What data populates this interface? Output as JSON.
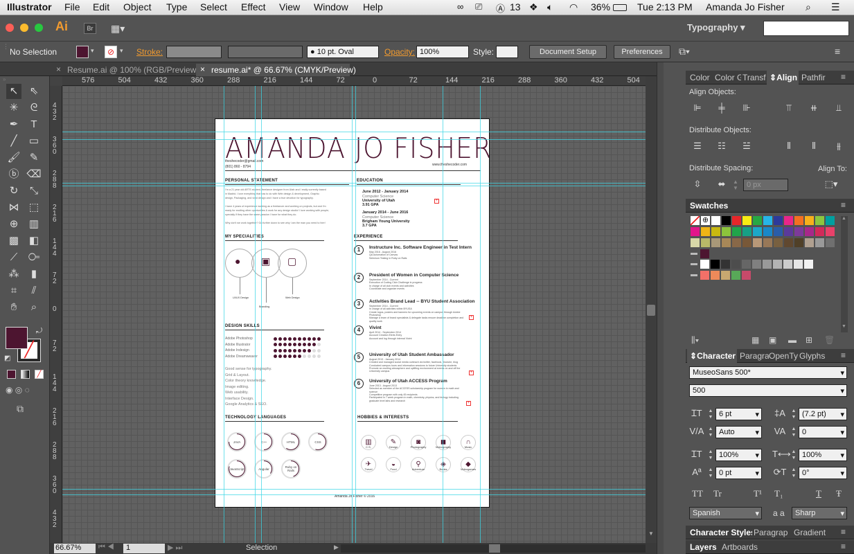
{
  "menubar": {
    "app": "Illustrator",
    "items": [
      "File",
      "Edit",
      "Object",
      "Type",
      "Select",
      "Effect",
      "View",
      "Window",
      "Help"
    ],
    "status": {
      "adobe_count": "13",
      "battery": "36%",
      "clock": "Tue 2:13 PM",
      "user": "Amanda Jo Fisher"
    }
  },
  "appbar": {
    "logo": "Ai",
    "bridge": "Br",
    "workspace": "Typography",
    "search_value": ""
  },
  "control": {
    "selection": "No Selection",
    "stroke_label": "Stroke:",
    "brush": "10 pt. Oval",
    "opacity_label": "Opacity:",
    "opacity_value": "100%",
    "style_label": "Style:",
    "document_setup": "Document Setup",
    "preferences": "Preferences"
  },
  "tabs": [
    {
      "label": "Resume.ai @ 100% (RGB/Preview)",
      "active": false
    },
    {
      "label": "resume.ai* @ 66.67% (CMYK/Preview)",
      "active": true
    }
  ],
  "ruler": {
    "h": [
      "576",
      "504",
      "432",
      "360",
      "288",
      "216",
      "144",
      "72",
      "0",
      "72",
      "144",
      "216",
      "288",
      "360",
      "432",
      "504",
      "576"
    ],
    "v": [
      "4 3 2",
      "3 6 0",
      "2 8 8",
      "2 1 6",
      "1 4 4",
      "7 2",
      "0",
      "7 2",
      "1 4 4",
      "2 1 6",
      "2 8 8",
      "3 6 0",
      "4 3 2"
    ]
  },
  "status": {
    "zoom": "66.67%",
    "page": "1",
    "tool": "Selection"
  },
  "resume": {
    "name": "AMANDA JO FISHER",
    "email": "theshecoder@gmail.com",
    "phone": "(801) 860 - 8794",
    "website": "www.theshecoder.com",
    "personal_statement_h": "PERSONAL STATEMENT",
    "personal_statement": [
      "I'm a 21 year old ARTS student, freelance designer from Utah and I really currently based",
      "in Madrid. I love everything that has to do with Web design & development, Graphic",
      "design, Packaging, and vivid design and I have a true devotion for typography.",
      "I have 4 years of experience working as a freelancer and working on projects, but and I'm",
      "ready for exciting other oportunities & work for any design studio! I love working with people,",
      "specially if they have the same passion I have for what they do.",
      "Why don't we work together? Go further down to see why I am the man you need to hire!"
    ],
    "education_h": "EDUCATION",
    "education": [
      {
        "dates": "June 2012 - January 2014",
        "field": "Computer Science",
        "school": "University of Utah",
        "gpa": "3.91 GPA"
      },
      {
        "dates": "January 2014 - June 2016",
        "field": "Computer Science",
        "school": "Brigham Young University",
        "gpa": "3.7 GPA"
      }
    ],
    "specialties_h": "MY SPECIALITIES",
    "specialties": [
      "UI/UX Design",
      "Branding",
      "Web Design"
    ],
    "experience_h": "EXPERIENCE",
    "experience": [
      {
        "n": "1",
        "title": "Instructure Inc. Software Engineer in Test Intern",
        "lines": [
          "May 2016 - August 2016",
          "QA Automation of Canvas",
          "Selenium Testing in Ruby on Rails"
        ]
      },
      {
        "n": "2",
        "title": "President of Women in Computer Science",
        "lines": [
          "September 2014 - Current",
          "Execution of Coding Club Challenge in progress",
          "In charge of all club events and activities",
          "Coordinate and organize events"
        ]
      },
      {
        "n": "3",
        "title": "Activities Brand Lead -- BYU Student Association",
        "lines": [
          "September 2014 - Current",
          "In charge of all activities within BYUSA",
          "Create logos, posters and banners for upcoming events on campus through Adobe",
          "Photoshop",
          "Manage a team of brand specialists & delegate tasks ensure deadline completion and",
          "quality work"
        ]
      },
      {
        "n": "4",
        "title": "Vivint",
        "lines": [
          "April 2014 - September 2014",
          "Account Creation Elerts Entry",
          "Account and log through internal Vivint"
        ]
      },
      {
        "n": "5",
        "title": "University of Utah Student Ambassador",
        "lines": [
          "August 2013 - January 2014",
          "Created and managed social media outreach via twitter, facebook, Youtube, blog",
          "Conducted campus tours and information sessions to future University students",
          "Promote an exciting atmosphere and uplifting environment at events on and off the",
          "University campus"
        ]
      },
      {
        "n": "6",
        "title": "University of Utah ACCESS Program",
        "lines": [
          "June 2013 - August 2013",
          "Selected as member of the ACCESS scholarship program for women in math and",
          "science",
          "Competitive program with only 45 recipients",
          "Participated in 7 week program in math, chemistry, physics, and biology including",
          "graduate level labs and research"
        ]
      }
    ],
    "design_skills_h": "DESIGN SKILLS",
    "design_skills": [
      {
        "name": "Adobe Photoshop",
        "level": 10
      },
      {
        "name": "Adobe Illustrator",
        "level": 9
      },
      {
        "name": "Adobe Indesign",
        "level": 8
      },
      {
        "name": "Adobe Dreamweaver",
        "level": 6
      }
    ],
    "skills_list": [
      "Good sense for typography.",
      "Grid & Layout.",
      "Color theory knowledge.",
      "Image editing.",
      "Web usability.",
      "Interface Design.",
      "Google Analytics & SEO."
    ],
    "tech_h": "TECHNOLOGY LANGUAGES",
    "tech": [
      {
        "name": "JAVA",
        "level": 0.75
      },
      {
        "name": "C++",
        "level": 0.5
      },
      {
        "name": "HTML",
        "level": 0.6
      },
      {
        "name": "CSS",
        "level": 0.55
      },
      {
        "name": "JavaScript",
        "level": 0.8
      },
      {
        "name": "Angular",
        "level": 0.35
      },
      {
        "name": "Ruby on Rails",
        "level": 0.45
      }
    ],
    "hobbies_h": "HOBBIES & INTERESTS",
    "hobbies": [
      "C.S.",
      "Design",
      "Photography",
      "Videography",
      "Music",
      "Travel",
      "Food",
      "Adventure",
      "Books",
      "Videogames"
    ],
    "footer": "Amanda Jo Fisher © 2016"
  },
  "panels": {
    "top_tabs": [
      "Color",
      "Color G",
      "Transf",
      "Align",
      "Pathfir"
    ],
    "active_top_tab": "Align",
    "align_objects": "Align Objects:",
    "distribute_objects": "Distribute Objects:",
    "distribute_spacing": "Distribute Spacing:",
    "align_to": "Align To:",
    "spacing_value": "0 px",
    "swatches_h": "Swatches",
    "char_tabs": [
      "Character",
      "Paragra",
      "OpenTy",
      "Glyphs"
    ],
    "font_family": "MuseoSans 500*",
    "font_style": "500",
    "size": "6 pt",
    "leading": "(7.2 pt)",
    "kerning": "Auto",
    "tracking": "0",
    "vscale": "100%",
    "hscale": "100%",
    "baseline": "0 pt",
    "rotation": "0°",
    "case_buttons": [
      "TT",
      "Tr",
      "T¹",
      "T₁",
      "T",
      "Ŧ"
    ],
    "language": "Spanish",
    "aa_label": "a a",
    "anti_alias": "Sharp",
    "bottom_tabs_1": [
      "Character Styles",
      "Paragrap",
      "Gradient"
    ],
    "bottom_tabs_2": [
      "Layers",
      "Artboards"
    ]
  },
  "colors": {
    "accent": "#4d1530",
    "guide": "#3fd7e6",
    "fill": "#4d1530"
  },
  "swatches_rows": [
    [
      "none",
      "reg",
      "#ffffff",
      "#000000",
      "#e8262a",
      "#f7ec13",
      "#27a843",
      "#27b5e8",
      "#2d3a9a",
      "#e8268a",
      "#f37021",
      "#f8b01b",
      "#8cc63f",
      "#00a0a0"
    ],
    [
      "#e2168b",
      "#f0b515",
      "#c8b810",
      "#8cc43c",
      "#20a54a",
      "#16a085",
      "#1ca8c8",
      "#1a88c8",
      "#2a5da8",
      "#5b3a9a",
      "#7d3a9a",
      "#a8288a",
      "#d12a5a",
      "#e8416a"
    ],
    [
      "#d8d8a8",
      "#b8b868",
      "#a89878",
      "#a88858",
      "#886848",
      "#785838",
      "#b89878",
      "#987858",
      "#786040",
      "#604830",
      "#504028",
      "#b0a090",
      "#9a9a9a",
      "#707070"
    ],
    [
      "#4d1530"
    ],
    [
      "#ffffff",
      "#000000",
      "#333333",
      "#4d4d4d",
      "#666666",
      "#808080",
      "#999999",
      "#b3b3b3",
      "#cccccc",
      "#e6e6e6",
      "#f2f2f2"
    ],
    [
      "#f37068",
      "#ee8a5a",
      "#c8a870",
      "#58a858",
      "#c84a6a"
    ]
  ]
}
